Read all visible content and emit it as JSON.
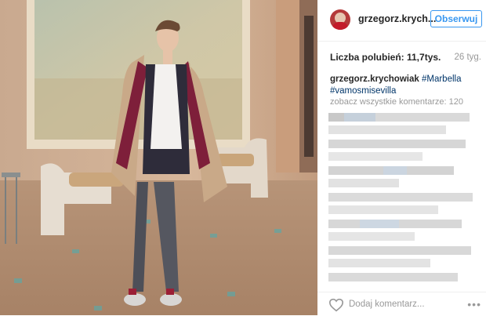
{
  "post": {
    "username": "grzegorz.krych...",
    "follow_label": "Obserwuj",
    "likes_text": "Liczba polubień: 11,7tys.",
    "time_ago": "26 tyg.",
    "caption_user": "grzegorz.krychowiak",
    "caption_tag_1": "#Marbella",
    "caption_tag_2": "#vamosmisevilla",
    "view_all_comments": "zobacz wszystkie komentarze: 120",
    "add_comment_placeholder": "Dodaj komentarz...",
    "more_options": "•••"
  },
  "icons": {
    "like": "heart-outline-icon",
    "options": "more-options-icon"
  },
  "colors": {
    "follow_blue": "#3897f0",
    "hashtag": "#003569",
    "muted": "#999999"
  }
}
